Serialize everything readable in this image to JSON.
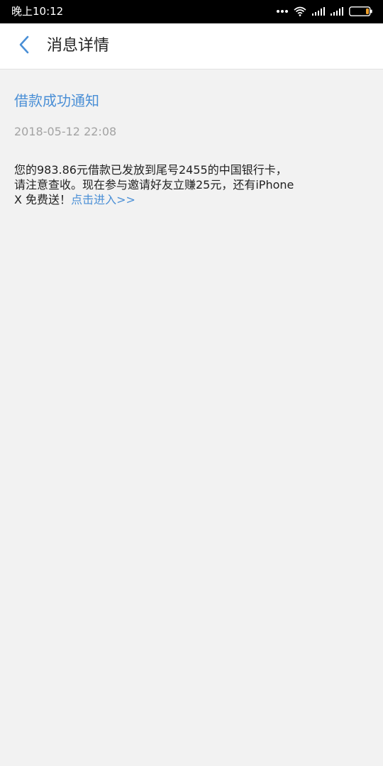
{
  "status_bar": {
    "time": "晚上10:12",
    "icons": [
      "more-dots-icon",
      "wifi-icon",
      "signal-icon",
      "signal-icon",
      "battery-icon"
    ],
    "battery_color": "#f0a02a"
  },
  "header": {
    "title": "消息详情",
    "back_icon": "chevron-left-icon",
    "accent_color": "#4a8fd6"
  },
  "message": {
    "title": "借款成功通知",
    "timestamp": "2018-05-12 22:08",
    "body_line1": "您的983.86元借款已发放到尾号2455的中国银行卡，",
    "body_line2": "请注意查收。现在参与邀请好友立赚25元，还有iPhone",
    "body_line3": "X 免费送！",
    "link_text": "点击进入>>"
  }
}
